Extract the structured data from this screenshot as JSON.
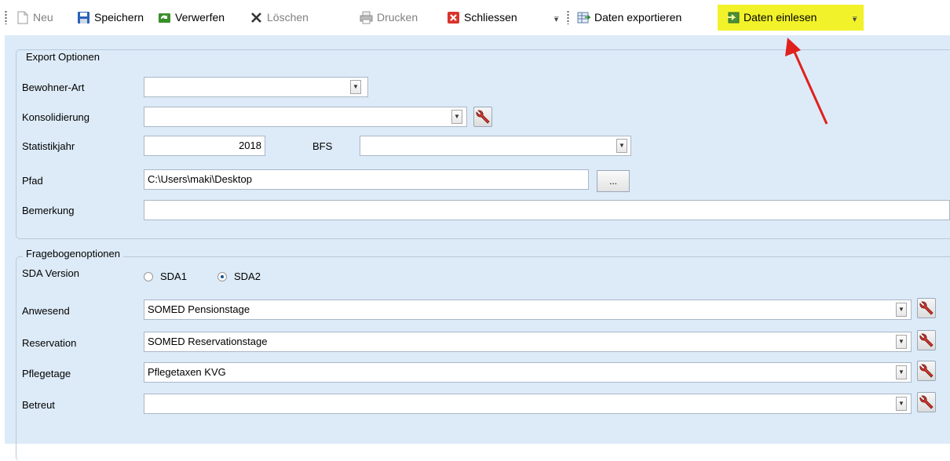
{
  "toolbar": {
    "new_label": "Neu",
    "save_label": "Speichern",
    "discard_label": "Verwerfen",
    "delete_label": "Löschen",
    "print_label": "Drucken",
    "close_label": "Schliessen",
    "export_label": "Daten exportieren",
    "import_label": "Daten einlesen",
    "highlight_color": "#f2f22a"
  },
  "export_options": {
    "legend": "Export Optionen",
    "bewohner_art_label": "Bewohner-Art",
    "bewohner_art_value": "",
    "konsolidierung_label": "Konsolidierung",
    "konsolidierung_value": "",
    "statistikjahr_label": "Statistikjahr",
    "statistikjahr_value": "2018",
    "bfs_label": "BFS",
    "bfs_value": "",
    "pfad_label": "Pfad",
    "pfad_value": "C:\\Users\\maki\\Desktop",
    "browse_label": "...",
    "bemerkung_label": "Bemerkung",
    "bemerkung_value": ""
  },
  "questionnaire": {
    "legend": "Fragebogenoptionen",
    "sda_version_label": "SDA Version",
    "sda1_label": "SDA1",
    "sda2_label": "SDA2",
    "selected": "SDA2",
    "anwesend_label": "Anwesend",
    "anwesend_value": "SOMED Pensionstage",
    "reservation_label": "Reservation",
    "reservation_value": "SOMED Reservationstage",
    "pflegetage_label": "Pflegetage",
    "pflegetage_value": "Pflegetaxen KVG",
    "betreut_label": "Betreut",
    "betreut_value": ""
  },
  "colors": {
    "panel_bg": "#ddebf8",
    "arrow": "#e0201c"
  }
}
